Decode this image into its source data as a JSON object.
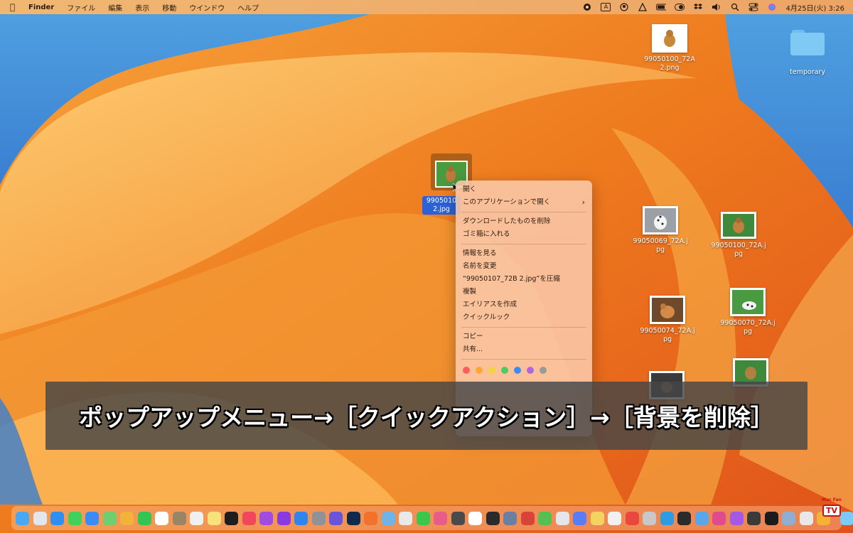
{
  "menubar": {
    "app_name": "Finder",
    "items": [
      "ファイル",
      "編集",
      "表示",
      "移動",
      "ウインドウ",
      "ヘルプ"
    ],
    "status_icons": [
      "record-icon",
      "input-a-icon",
      "user-circle-icon",
      "drive-icon",
      "battery-icon",
      "toggle-icon",
      "dropbox-icon",
      "volume-icon",
      "search-icon",
      "control-center-icon",
      "siri-icon"
    ],
    "input_label": "A",
    "clock": "4月25日(火) 3:26"
  },
  "desktop": {
    "top_file_label": "99050100_72A\n2.png",
    "folder_label": "temporary",
    "selected_file_label": "99050107_72B 2.jpg",
    "selected_file_visible_label": "9905010\n2.jpg",
    "files": [
      {
        "name": "99050069_72A.jpg"
      },
      {
        "name": "99050100_72A.jpg"
      },
      {
        "name": "99050074_72A.jpg"
      },
      {
        "name": "99050070_72A.jpg"
      }
    ]
  },
  "context_menu": {
    "group1": [
      "開く",
      "このアプリケーションで開く"
    ],
    "group2": [
      "ダウンロードしたものを削除",
      "ゴミ箱に入れる"
    ],
    "group3": [
      "情報を見る",
      "名前を変更",
      "“99050107_72B 2.jpg”を圧縮",
      "複製",
      "エイリアスを作成",
      "クイックルック"
    ],
    "group4": [
      "コピー",
      "共有..."
    ],
    "tag_colors": [
      "#ff5d5d",
      "#ffa53a",
      "#f5d33d",
      "#4ecb5e",
      "#3b8df5",
      "#b066e0",
      "#9a9a9a"
    ],
    "submenu_arrow": "›"
  },
  "caption": {
    "text": "ポップアップメニュー→［クイックアクション］→［背景を削除］"
  },
  "dock": {
    "apps": [
      {
        "name": "finder-icon",
        "color": "#4aa7f2"
      },
      {
        "name": "launchpad-icon",
        "color": "#e3e6ef"
      },
      {
        "name": "safari-icon",
        "color": "#2f8ff0"
      },
      {
        "name": "messages-icon",
        "color": "#3fd15a"
      },
      {
        "name": "mail-icon",
        "color": "#3b8df5"
      },
      {
        "name": "maps-icon",
        "color": "#6fcf6f"
      },
      {
        "name": "photos-icon",
        "color": "#f3b23a"
      },
      {
        "name": "facetime-icon",
        "color": "#33c553"
      },
      {
        "name": "calendar-icon",
        "color": "#ffffff"
      },
      {
        "name": "notes-app-icon",
        "color": "#9a8466"
      },
      {
        "name": "reminders-icon",
        "color": "#f0f0f0"
      },
      {
        "name": "notes-icon",
        "color": "#f9e27a"
      },
      {
        "name": "tv-icon",
        "color": "#1d1d1d"
      },
      {
        "name": "music-icon",
        "color": "#f2465d"
      },
      {
        "name": "podcasts-icon",
        "color": "#a14ce0"
      },
      {
        "name": "podcast-purple-icon",
        "color": "#8a3be0"
      },
      {
        "name": "app-store-icon",
        "color": "#2f85f0"
      },
      {
        "name": "system-settings-icon",
        "color": "#8f9298"
      },
      {
        "name": "imovie-icon",
        "color": "#6a55d8"
      },
      {
        "name": "photoshop-icon",
        "color": "#0f2a4d"
      },
      {
        "name": "firefox-icon",
        "color": "#f2722c"
      },
      {
        "name": "preview-icon",
        "color": "#6fb3e8"
      },
      {
        "name": "chrome-icon",
        "color": "#e9e9e9"
      },
      {
        "name": "line-icon",
        "color": "#3cc74c"
      },
      {
        "name": "slideshow-icon",
        "color": "#e85c8a"
      },
      {
        "name": "camera-icon",
        "color": "#4a4a4a"
      },
      {
        "name": "tn-icon",
        "color": "#ffffff"
      },
      {
        "name": "terminal-icon",
        "color": "#2b2b2b"
      },
      {
        "name": "screenshot-icon",
        "color": "#6b7fa0"
      },
      {
        "name": "delete-icon",
        "color": "#d9433a"
      },
      {
        "name": "numbers-icon",
        "color": "#54c04f"
      },
      {
        "name": "keynote-icon",
        "color": "#e4e6ea"
      },
      {
        "name": "messenger-icon",
        "color": "#5a7cf5"
      },
      {
        "name": "script-icon",
        "color": "#f4d45f"
      },
      {
        "name": "google-chrome-icon",
        "color": "#f1f1f1"
      },
      {
        "name": "creative-cloud-icon",
        "color": "#e8483d"
      },
      {
        "name": "automator-icon",
        "color": "#c8c8c8"
      },
      {
        "name": "sync-icon",
        "color": "#2f9be0"
      },
      {
        "name": "clock-app-icon",
        "color": "#2b2b2b"
      },
      {
        "name": "text-edit-icon",
        "color": "#5ba6e8"
      },
      {
        "name": "grammarly-icon",
        "color": "#e14a8c"
      },
      {
        "name": "bookmark-icon",
        "color": "#a458e6"
      },
      {
        "name": "capture-icon",
        "color": "#3a3a3a"
      },
      {
        "name": "capcut-icon",
        "color": "#1b1b1b"
      },
      {
        "name": "bridge-icon",
        "color": "#8faed1"
      },
      {
        "name": "accessibility-icon",
        "color": "#e8e8e8"
      },
      {
        "name": "transmit-icon",
        "color": "#f5b335"
      }
    ],
    "trailing": [
      {
        "name": "downloads-folder-icon",
        "color": "#7fcaf5"
      },
      {
        "name": "trash-icon",
        "color": "#d8d8d8"
      }
    ]
  },
  "branding": {
    "small_text": "Mac Fan",
    "tv_text": "TV"
  }
}
